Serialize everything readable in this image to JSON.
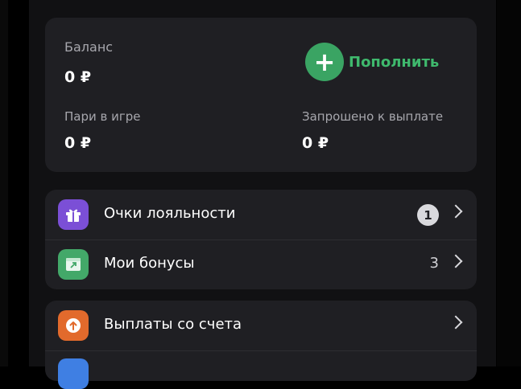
{
  "balance": {
    "label": "Баланс",
    "amount": "0 ₽",
    "topup_label": "Пополнить",
    "bets_label": "Пари в игре",
    "bets_amount": "0 ₽",
    "requested_label": "Запрошено к выплате",
    "requested_amount": "0 ₽"
  },
  "menu": {
    "loyalty": {
      "label": "Очки лояльности",
      "badge": "1",
      "icon": "gift-icon",
      "color": "#7b4fd6"
    },
    "bonuses": {
      "label": "Мои бонусы",
      "count": "3",
      "icon": "bonus-icon",
      "color": "#43a869"
    },
    "payouts": {
      "label": "Выплаты со счета",
      "icon": "arrow-up-icon",
      "color": "#e26a2c"
    },
    "next": {
      "icon": "partial-icon",
      "color": "#3f7fe3"
    }
  }
}
